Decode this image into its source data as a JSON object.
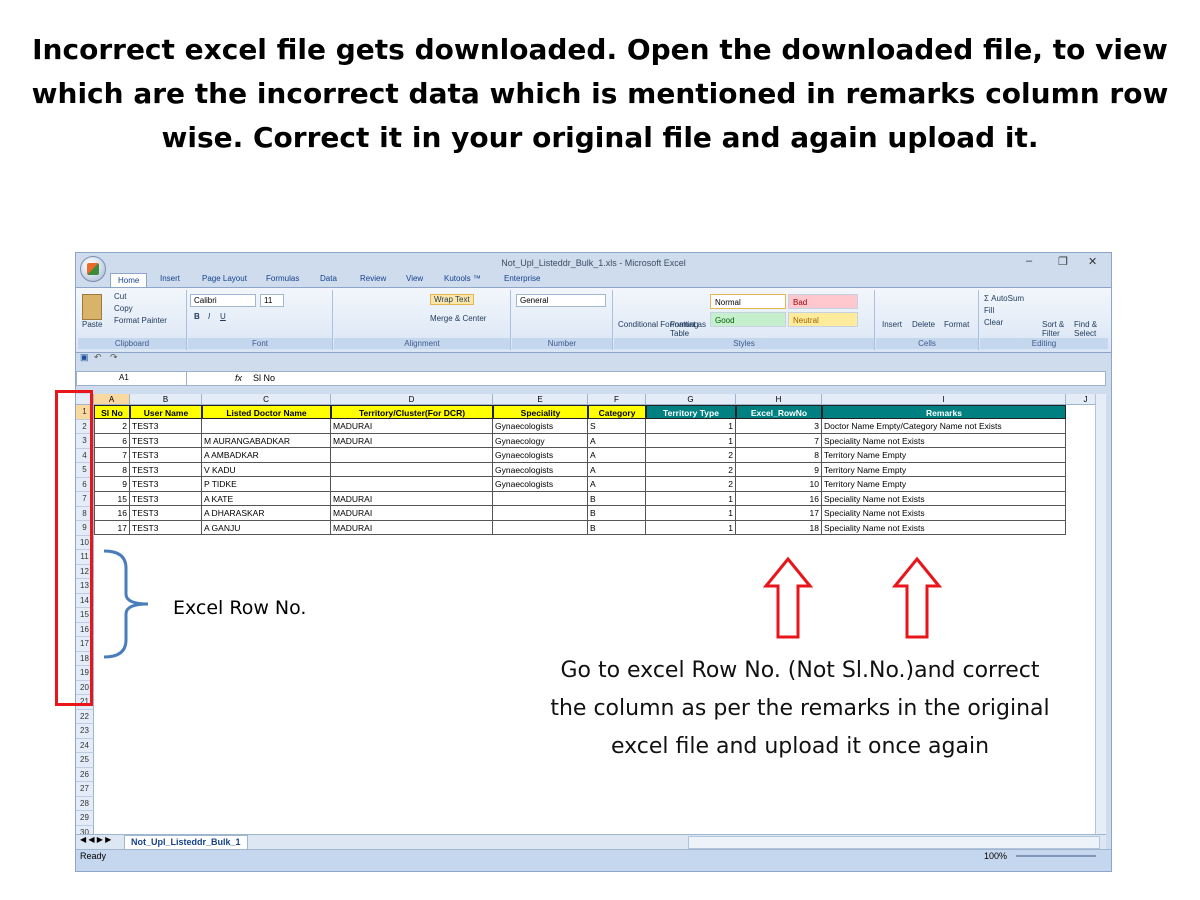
{
  "slide": {
    "title": "Incorrect excel file gets downloaded. Open the downloaded file, to view which are the incorrect data which is mentioned in remarks column row wise. Correct it in your original file and again upload it.",
    "row_annotation": "Excel Row No.",
    "instruction": "Go to excel Row No. (Not Sl.No.)and correct the column as per the remarks in the original excel file and upload it once again"
  },
  "window": {
    "title": "Not_Upl_Listeddr_Bulk_1.xls - Microsoft Excel",
    "minimize": "–",
    "maximize": "❐",
    "close": "✕"
  },
  "tabs": [
    "Home",
    "Insert",
    "Page Layout",
    "Formulas",
    "Data",
    "Review",
    "View",
    "Kutools ™",
    "Enterprise"
  ],
  "ribbon": {
    "clipboard": {
      "label": "Clipboard",
      "paste": "Paste",
      "cut": "Cut",
      "copy": "Copy",
      "format_painter": "Format Painter"
    },
    "font": {
      "label": "Font",
      "name": "Calibri",
      "size": "11"
    },
    "alignment": {
      "label": "Alignment",
      "wrap": "Wrap Text",
      "merge": "Merge & Center"
    },
    "number": {
      "label": "Number",
      "format": "General"
    },
    "styles": {
      "label": "Styles",
      "conditional": "Conditional Formatting",
      "format_table": "Format as Table",
      "normal": "Normal",
      "bad": "Bad",
      "good": "Good",
      "neutral": "Neutral"
    },
    "cells": {
      "label": "Cells",
      "insert": "Insert",
      "delete": "Delete",
      "format": "Format"
    },
    "editing": {
      "label": "Editing",
      "autosum": "AutoSum",
      "fill": "Fill",
      "clear": "Clear",
      "sort": "Sort & Filter",
      "find": "Find & Select"
    }
  },
  "formula_bar": {
    "name_box": "A1",
    "fx": "fx",
    "value": "Sl No"
  },
  "columns": [
    "A",
    "B",
    "C",
    "D",
    "E",
    "F",
    "G",
    "H",
    "I",
    "J"
  ],
  "headers": [
    "Sl No",
    "User Name",
    "Listed Doctor Name",
    "Territory/Cluster(For DCR)",
    "Speciality",
    "Category",
    "Territory Type",
    "Excel_RowNo",
    "Remarks"
  ],
  "rows": [
    [
      "2",
      "TEST3",
      "",
      "MADURAI",
      "Gynaecologists",
      "S",
      "1",
      "3",
      "Doctor Name Empty/Category Name not Exists"
    ],
    [
      "6",
      "TEST3",
      "M AURANGABADKAR",
      "MADURAI",
      "Gynaecology",
      "A",
      "1",
      "7",
      "Speciality Name not Exists"
    ],
    [
      "7",
      "TEST3",
      "A AMBADKAR",
      "",
      "Gynaecologists",
      "A",
      "2",
      "8",
      "Territory Name Empty"
    ],
    [
      "8",
      "TEST3",
      "V KADU",
      "",
      "Gynaecologists",
      "A",
      "2",
      "9",
      "Territory Name Empty"
    ],
    [
      "9",
      "TEST3",
      "P TIDKE",
      "",
      "Gynaecologists",
      "A",
      "2",
      "10",
      "Territory Name Empty"
    ],
    [
      "15",
      "TEST3",
      "A KATE",
      "MADURAI",
      "",
      "B",
      "1",
      "16",
      "Speciality Name not Exists"
    ],
    [
      "16",
      "TEST3",
      "A DHARASKAR",
      "MADURAI",
      "",
      "B",
      "1",
      "17",
      "Speciality Name not Exists"
    ],
    [
      "17",
      "TEST3",
      "A GANJU",
      "MADURAI",
      "",
      "B",
      "1",
      "18",
      "Speciality Name not Exists"
    ]
  ],
  "row_numbers": [
    "1",
    "2",
    "3",
    "4",
    "5",
    "6",
    "7",
    "8",
    "9",
    "10",
    "11",
    "12",
    "13",
    "14",
    "15",
    "16",
    "17",
    "18",
    "19",
    "20",
    "21",
    "22",
    "23",
    "24",
    "25",
    "26",
    "27",
    "28",
    "29",
    "30"
  ],
  "sheet_tab": "Not_Upl_Listeddr_Bulk_1",
  "status": {
    "ready": "Ready",
    "zoom": "100%"
  },
  "colors": {
    "header_yellow": "#ffff00",
    "header_teal": "#008080",
    "highlight_red": "#e8161b",
    "brace_blue": "#4a7ebb"
  }
}
